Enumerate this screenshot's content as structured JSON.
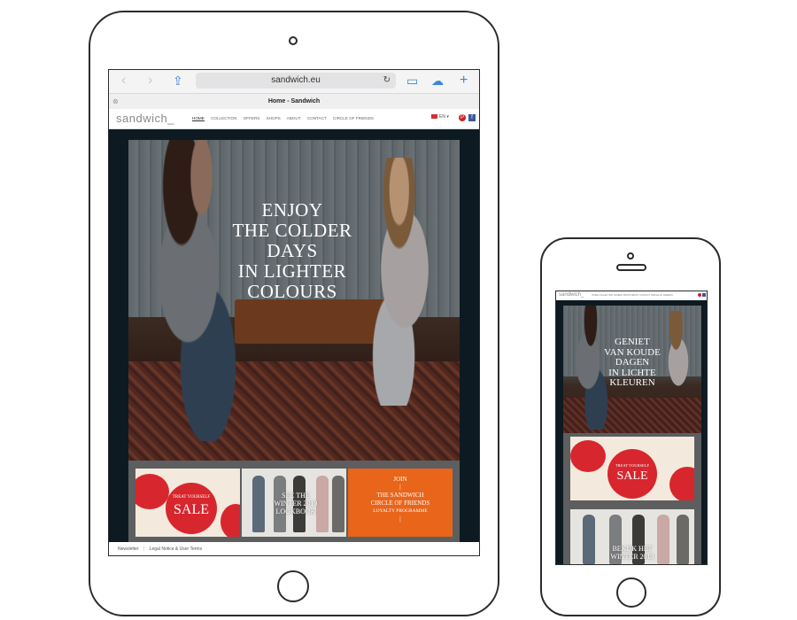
{
  "tablet": {
    "browser": {
      "url": "sandwich.eu",
      "tab_title": "Home - Sandwich",
      "back_icon": "‹",
      "forward_icon": "›",
      "share_icon": "⇪",
      "reload_icon": "↻",
      "bookmarks_icon": "▭",
      "cloud_icon": "☁",
      "new_tab_icon": "+",
      "close_tab_icon": "⊗"
    },
    "site": {
      "logo": "sandwich_",
      "nav": [
        "HOME",
        "COLLECTION",
        "OFFERS",
        "SHOPS",
        "ABOUT",
        "CONTACT",
        "CIRCLE OF FRIENDS"
      ],
      "language": "EN",
      "social": [
        "P",
        "f"
      ]
    },
    "hero": {
      "headline": [
        "ENJOY",
        "THE COLDER",
        "DAYS",
        "IN LIGHTER",
        "COLOURS"
      ]
    },
    "tiles": {
      "sale_small": "TREAT YOURSELF",
      "sale_big": "SALE",
      "lookbook": [
        "SEE THE",
        "WINTER 2013",
        "LOOKBOOK"
      ],
      "join": [
        "JOIN",
        "|",
        "THE SANDWICH",
        "CIRCLE OF FRIENDS",
        "LOYALTY PROGRAMME",
        "|"
      ]
    },
    "footer": {
      "links": [
        "Newsletter",
        "Legal Notice & User Terms"
      ]
    }
  },
  "phone": {
    "logo": "sandwich_",
    "nav": "HOME  COLLECTION  OFFERS  SHOPS  ABOUT  CONTACT  CIRCLE OF FRIENDS",
    "hero": {
      "headline": [
        "GENIET",
        "VAN KOUDE",
        "DAGEN",
        "IN LICHTE",
        "KLEUREN"
      ]
    },
    "tiles": {
      "sale_small": "TREAT YOURSELF",
      "sale_big": "SALE",
      "lookbook": [
        "BEKIJK HET",
        "WINTER 2013"
      ]
    }
  },
  "colors": {
    "accent_orange": "#e8651a",
    "sale_red": "#d8262e",
    "link_blue": "#3a86d8"
  }
}
